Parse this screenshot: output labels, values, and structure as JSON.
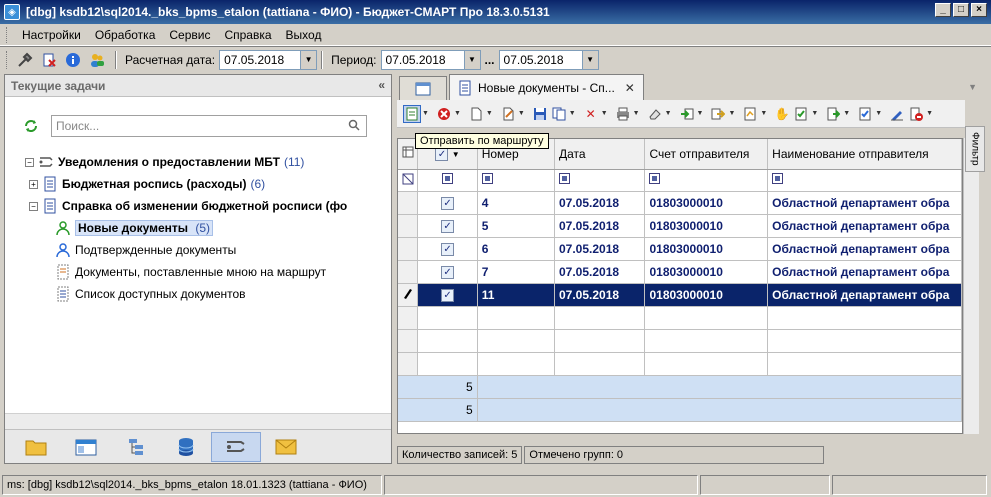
{
  "window": {
    "title": "[dbg] ksdb12\\sql2014._bks_bpms_etalon (tattiana - ФИО) - Бюджет-СМАРТ Про 18.3.0.5131"
  },
  "menu": [
    "Настройки",
    "Обработка",
    "Сервис",
    "Справка",
    "Выход"
  ],
  "toolbar": {
    "calc_date_label": "Расчетная дата:",
    "calc_date": "07.05.2018",
    "period_label": "Период:",
    "period_from": "07.05.2018",
    "range_sep": "...",
    "period_to": "07.05.2018"
  },
  "left_panel": {
    "title": "Текущие задачи",
    "collapse": "«",
    "search_placeholder": "Поиск...",
    "tree": {
      "root": {
        "label": "Уведомления о предоставлении МБТ",
        "count": "(11)"
      },
      "budget": {
        "label": "Бюджетная роспись (расходы)",
        "count": "(6)"
      },
      "spravka": {
        "label": "Справка об изменении бюджетной росписи (фо"
      },
      "new_docs": {
        "label": "Новые документы",
        "count": "(5)"
      },
      "confirmed": {
        "label": "Подтвержденные документы"
      },
      "routed": {
        "label": "Документы, поставленные мною на маршрут"
      },
      "available": {
        "label": "Список доступных документов"
      }
    }
  },
  "tabs": {
    "active": "Новые документы - Сп..."
  },
  "tooltip": "Отправить по маршруту",
  "grid": {
    "columns": [
      "Номер",
      "Дата",
      "Счет отправителя",
      "Наименование отправителя"
    ],
    "rows": [
      {
        "num": "4",
        "date": "07.05.2018",
        "acct": "01803000010",
        "name": "Областной департамент обра"
      },
      {
        "num": "5",
        "date": "07.05.2018",
        "acct": "01803000010",
        "name": "Областной департамент обра"
      },
      {
        "num": "6",
        "date": "07.05.2018",
        "acct": "01803000010",
        "name": "Областной департамент обра"
      },
      {
        "num": "7",
        "date": "07.05.2018",
        "acct": "01803000010",
        "name": "Областной департамент обра"
      },
      {
        "num": "11",
        "date": "07.05.2018",
        "acct": "01803000010",
        "name": "Областной департамент обра"
      }
    ],
    "summary": [
      "5",
      "5"
    ],
    "filter_side": "Фильтр"
  },
  "grid_status": {
    "records": "Количество записей: 5",
    "groups": "Отмечено групп: 0"
  },
  "statusbar": {
    "conn": "ms: [dbg] ksdb12\\sql2014._bks_bpms_etalon 18.01.1323 (tattiana - ФИО)"
  },
  "colors": {
    "selection": "#0a246a",
    "row_text": "#102070",
    "summary_bg": "#cfe0f4"
  }
}
